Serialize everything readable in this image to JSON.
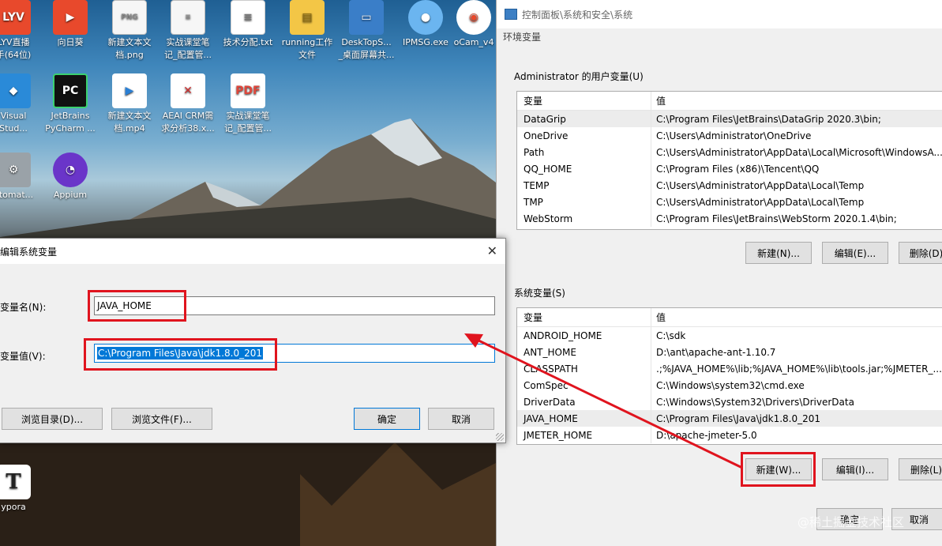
{
  "desktop": {
    "icons": [
      {
        "label": "LYV直播\n手(64位)",
        "icon": "lyv-app-icon",
        "badge": ""
      },
      {
        "label": "向日葵",
        "icon": "sunflower-icon",
        "badge": ""
      },
      {
        "label": "新建文本文\n档.png",
        "icon": "png-file-icon",
        "badge": "PNG"
      },
      {
        "label": "实战课堂笔\n记_配置管...",
        "icon": "document-icon",
        "badge": ""
      },
      {
        "label": "技术分配.txt",
        "icon": "txt-file-icon",
        "badge": ""
      },
      {
        "label": "running工作\n文件",
        "icon": "folder-icon",
        "badge": ""
      },
      {
        "label": "DeskTopS...\n_桌面屏幕共...",
        "icon": "monitor-icon",
        "badge": ""
      },
      {
        "label": "IPMSG.exe",
        "icon": "ipmsg-icon",
        "badge": ""
      },
      {
        "label": "oCam_v4",
        "icon": "ocam-icon",
        "badge": ""
      },
      {
        "label": "Visual\nStud...",
        "icon": "vscode-icon",
        "badge": ""
      },
      {
        "label": "JetBrains\nPyCharm ...",
        "icon": "pycharm-icon",
        "badge": "PC"
      },
      {
        "label": "新建文本文\n档.mp4",
        "icon": "video-file-icon",
        "badge": ""
      },
      {
        "label": "AEAI CRM需\n求分析38.x...",
        "icon": "crm-file-icon",
        "badge": ""
      },
      {
        "label": "实战课堂笔\n记_配置管...",
        "icon": "pdf-file-icon",
        "badge": "PDF"
      },
      {
        "label": "utomat...",
        "icon": "gear-icon",
        "badge": ""
      },
      {
        "label": "Appium",
        "icon": "appium-icon",
        "badge": ""
      },
      {
        "label": "ypora",
        "icon": "typora-icon",
        "badge": "T"
      }
    ]
  },
  "system_window": {
    "breadcrumb": "控制面板\\系统和安全\\系统",
    "dialog_title": "环境变量",
    "user_vars": {
      "group_label": "Administrator 的用户变量(U)",
      "col_var": "变量",
      "col_val": "值",
      "rows": [
        {
          "name": "DataGrip",
          "value": "C:\\Program Files\\JetBrains\\DataGrip 2020.3\\bin;"
        },
        {
          "name": "OneDrive",
          "value": "C:\\Users\\Administrator\\OneDrive"
        },
        {
          "name": "Path",
          "value": "C:\\Users\\Administrator\\AppData\\Local\\Microsoft\\WindowsA..."
        },
        {
          "name": "QQ_HOME",
          "value": "C:\\Program Files (x86)\\Tencent\\QQ"
        },
        {
          "name": "TEMP",
          "value": "C:\\Users\\Administrator\\AppData\\Local\\Temp"
        },
        {
          "name": "TMP",
          "value": "C:\\Users\\Administrator\\AppData\\Local\\Temp"
        },
        {
          "name": "WebStorm",
          "value": "C:\\Program Files\\JetBrains\\WebStorm 2020.1.4\\bin;"
        }
      ],
      "btn_new": "新建(N)...",
      "btn_edit": "编辑(E)...",
      "btn_delete": "删除(D)"
    },
    "system_vars": {
      "group_label": "系统变量(S)",
      "col_var": "变量",
      "col_val": "值",
      "rows": [
        {
          "name": "ANDROID_HOME",
          "value": "C:\\sdk"
        },
        {
          "name": "ANT_HOME",
          "value": "D:\\ant\\apache-ant-1.10.7"
        },
        {
          "name": "CLASSPATH",
          "value": ".;%JAVA_HOME%\\lib;%JAVA_HOME%\\lib\\tools.jar;%JMETER_..."
        },
        {
          "name": "ComSpec",
          "value": "C:\\Windows\\system32\\cmd.exe"
        },
        {
          "name": "DriverData",
          "value": "C:\\Windows\\System32\\Drivers\\DriverData"
        },
        {
          "name": "JAVA_HOME",
          "value": "C:\\Program Files\\Java\\jdk1.8.0_201"
        },
        {
          "name": "JMETER_HOME",
          "value": "D:\\apache-jmeter-5.0"
        }
      ],
      "btn_new": "新建(W)...",
      "btn_edit": "编辑(I)...",
      "btn_delete": "删除(L)"
    },
    "btn_ok": "确定",
    "btn_cancel": "取消"
  },
  "edit_dialog": {
    "title": "编辑系统变量",
    "close_glyph": "✕",
    "name_label": "变量名(N):",
    "name_value": "JAVA_HOME",
    "value_label": "变量值(V):",
    "value_value": "C:\\Program Files\\Java\\jdk1.8.0_201",
    "btn_browse_dir": "浏览目录(D)...",
    "btn_browse_file": "浏览文件(F)...",
    "btn_ok": "确定",
    "btn_cancel": "取消"
  },
  "watermark": "@稀土掘金技术社区",
  "colors": {
    "annotation": "#e0141e",
    "selection": "#0078d7"
  }
}
